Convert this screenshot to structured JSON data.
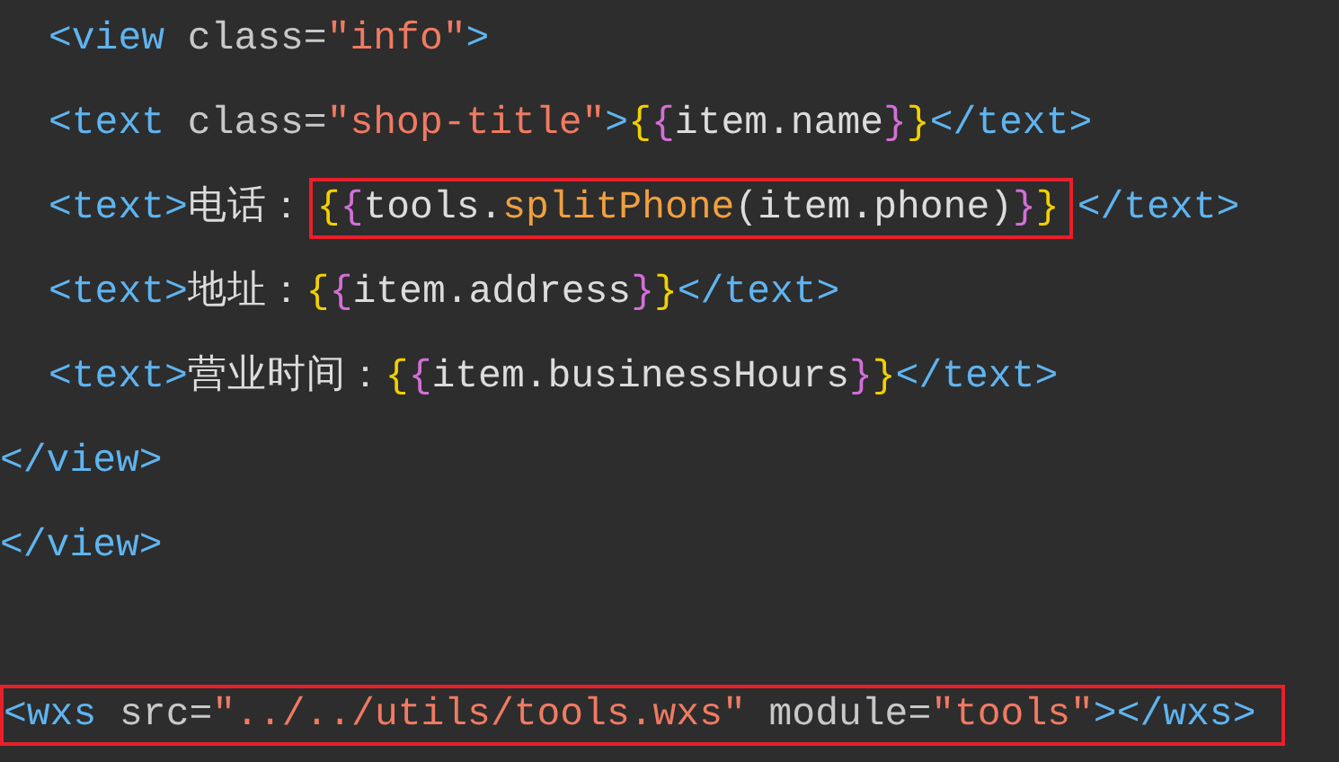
{
  "editor": {
    "lines": [
      {
        "kind": "code",
        "indented": true,
        "parts": [
          {
            "kind": "plain",
            "tokens": [
              {
                "kind": "tag",
                "text": "<view"
              },
              {
                "kind": "attr",
                "text": " class="
              },
              {
                "kind": "string",
                "text": "\"info\""
              },
              {
                "kind": "tag",
                "text": ">"
              }
            ]
          }
        ]
      },
      {
        "kind": "code",
        "indented": true,
        "parts": [
          {
            "kind": "plain",
            "tokens": [
              {
                "kind": "tag",
                "text": "<text"
              },
              {
                "kind": "attr",
                "text": " class="
              },
              {
                "kind": "string",
                "text": "\"shop-title\""
              },
              {
                "kind": "tag",
                "text": ">"
              },
              {
                "kind": "brace1",
                "text": "{"
              },
              {
                "kind": "brace2",
                "text": "{"
              },
              {
                "kind": "text",
                "text": "item.name"
              },
              {
                "kind": "brace2",
                "text": "}"
              },
              {
                "kind": "brace1",
                "text": "}"
              },
              {
                "kind": "tag",
                "text": "</text>"
              }
            ]
          }
        ]
      },
      {
        "kind": "code",
        "indented": true,
        "parts": [
          {
            "kind": "plain",
            "tokens": [
              {
                "kind": "tag",
                "text": "<text>"
              },
              {
                "kind": "text",
                "text": "电话："
              }
            ]
          },
          {
            "kind": "highlight",
            "tokens": [
              {
                "kind": "brace1",
                "text": "{"
              },
              {
                "kind": "brace2",
                "text": "{"
              },
              {
                "kind": "text",
                "text": "tools."
              },
              {
                "kind": "func",
                "text": "splitPhone"
              },
              {
                "kind": "text",
                "text": "(item.phone)"
              },
              {
                "kind": "brace2",
                "text": "}"
              },
              {
                "kind": "brace1",
                "text": "}"
              }
            ]
          },
          {
            "kind": "plain",
            "tokens": [
              {
                "kind": "tag",
                "text": "</text>"
              }
            ]
          }
        ]
      },
      {
        "kind": "code",
        "indented": true,
        "parts": [
          {
            "kind": "plain",
            "tokens": [
              {
                "kind": "tag",
                "text": "<text>"
              },
              {
                "kind": "text",
                "text": "地址："
              },
              {
                "kind": "brace1",
                "text": "{"
              },
              {
                "kind": "brace2",
                "text": "{"
              },
              {
                "kind": "text",
                "text": "item.address"
              },
              {
                "kind": "brace2",
                "text": "}"
              },
              {
                "kind": "brace1",
                "text": "}"
              },
              {
                "kind": "tag",
                "text": "</text>"
              }
            ]
          }
        ]
      },
      {
        "kind": "code",
        "indented": true,
        "parts": [
          {
            "kind": "plain",
            "tokens": [
              {
                "kind": "tag",
                "text": "<text>"
              },
              {
                "kind": "text",
                "text": "营业时间："
              },
              {
                "kind": "brace1",
                "text": "{"
              },
              {
                "kind": "brace2",
                "text": "{"
              },
              {
                "kind": "text",
                "text": "item.businessHours"
              },
              {
                "kind": "brace2",
                "text": "}"
              },
              {
                "kind": "brace1",
                "text": "}"
              },
              {
                "kind": "tag",
                "text": "</text>"
              }
            ]
          }
        ]
      },
      {
        "kind": "code",
        "indented": false,
        "parts": [
          {
            "kind": "plain",
            "tokens": [
              {
                "kind": "tag",
                "text": "</view>"
              }
            ]
          }
        ]
      },
      {
        "kind": "code",
        "indented": false,
        "parts": [
          {
            "kind": "plain",
            "tokens": [
              {
                "kind": "tag",
                "text": "</view>"
              }
            ]
          }
        ]
      },
      {
        "kind": "blank"
      },
      {
        "kind": "code",
        "indented": false,
        "parts": [
          {
            "kind": "highlight",
            "tokens": [
              {
                "kind": "tag",
                "text": "<wxs"
              },
              {
                "kind": "attr",
                "text": " src="
              },
              {
                "kind": "string",
                "text": "\"../../utils/tools.wxs\""
              },
              {
                "kind": "attr",
                "text": " module="
              },
              {
                "kind": "string",
                "text": "\"tools\""
              },
              {
                "kind": "tag",
                "text": "></wxs>"
              }
            ]
          }
        ]
      }
    ]
  }
}
